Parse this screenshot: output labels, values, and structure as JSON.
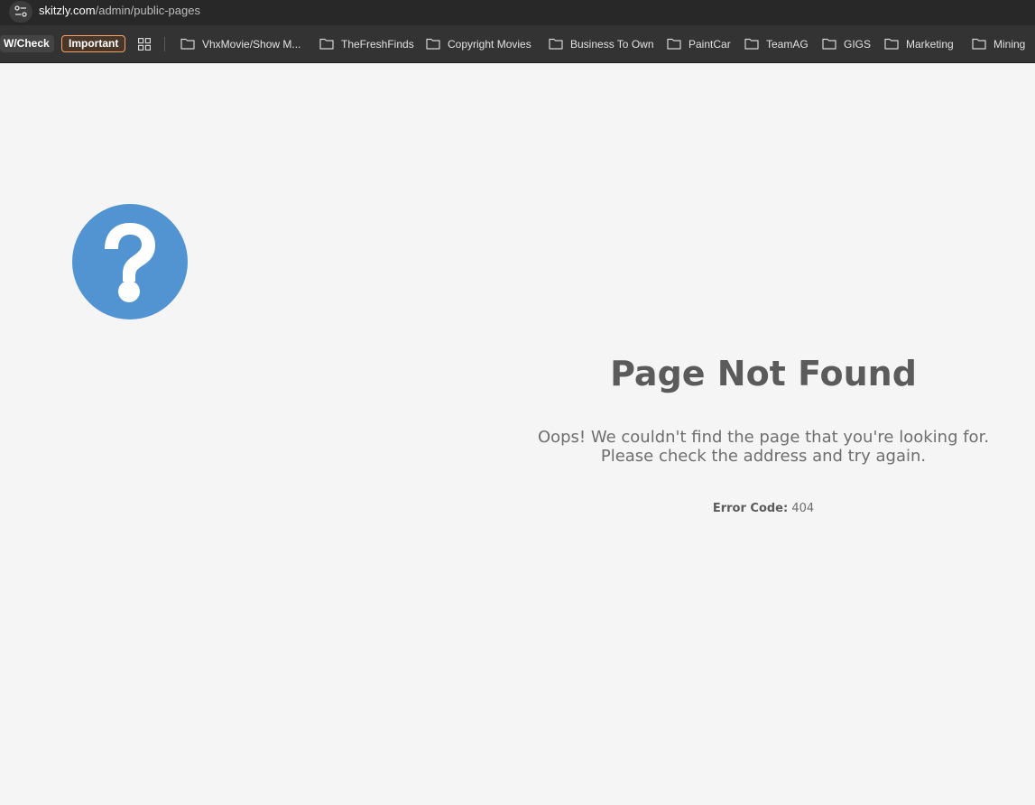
{
  "browser": {
    "url": {
      "host": "skitzly.com",
      "path": "/admin/public-pages"
    },
    "bookmarks": {
      "chips": [
        {
          "label": "W/Check"
        },
        {
          "label": "Important",
          "accent": "#f3a36a"
        }
      ],
      "folders": [
        {
          "label": "VhxMovie/Show M..."
        },
        {
          "label": "TheFreshFinds"
        },
        {
          "label": "Copyright Movies"
        },
        {
          "label": "Business To Own"
        },
        {
          "label": "PaintCar"
        },
        {
          "label": "TeamAG"
        },
        {
          "label": "GIGS"
        },
        {
          "label": "Marketing"
        },
        {
          "label": "Mining"
        }
      ]
    }
  },
  "page": {
    "icon": "question-circle-icon",
    "icon_color": "#5294d2",
    "title": "Page Not Found",
    "message_line1": "Oops! We couldn't find the page that you're looking for.",
    "message_line2": "Please check the address and try again.",
    "error_code_label": "Error Code:",
    "error_code_value": "404"
  },
  "colors": {
    "page_background": "#f5f5f6",
    "toolbar_background": "#333333",
    "title_text": "#5b5b5b"
  }
}
